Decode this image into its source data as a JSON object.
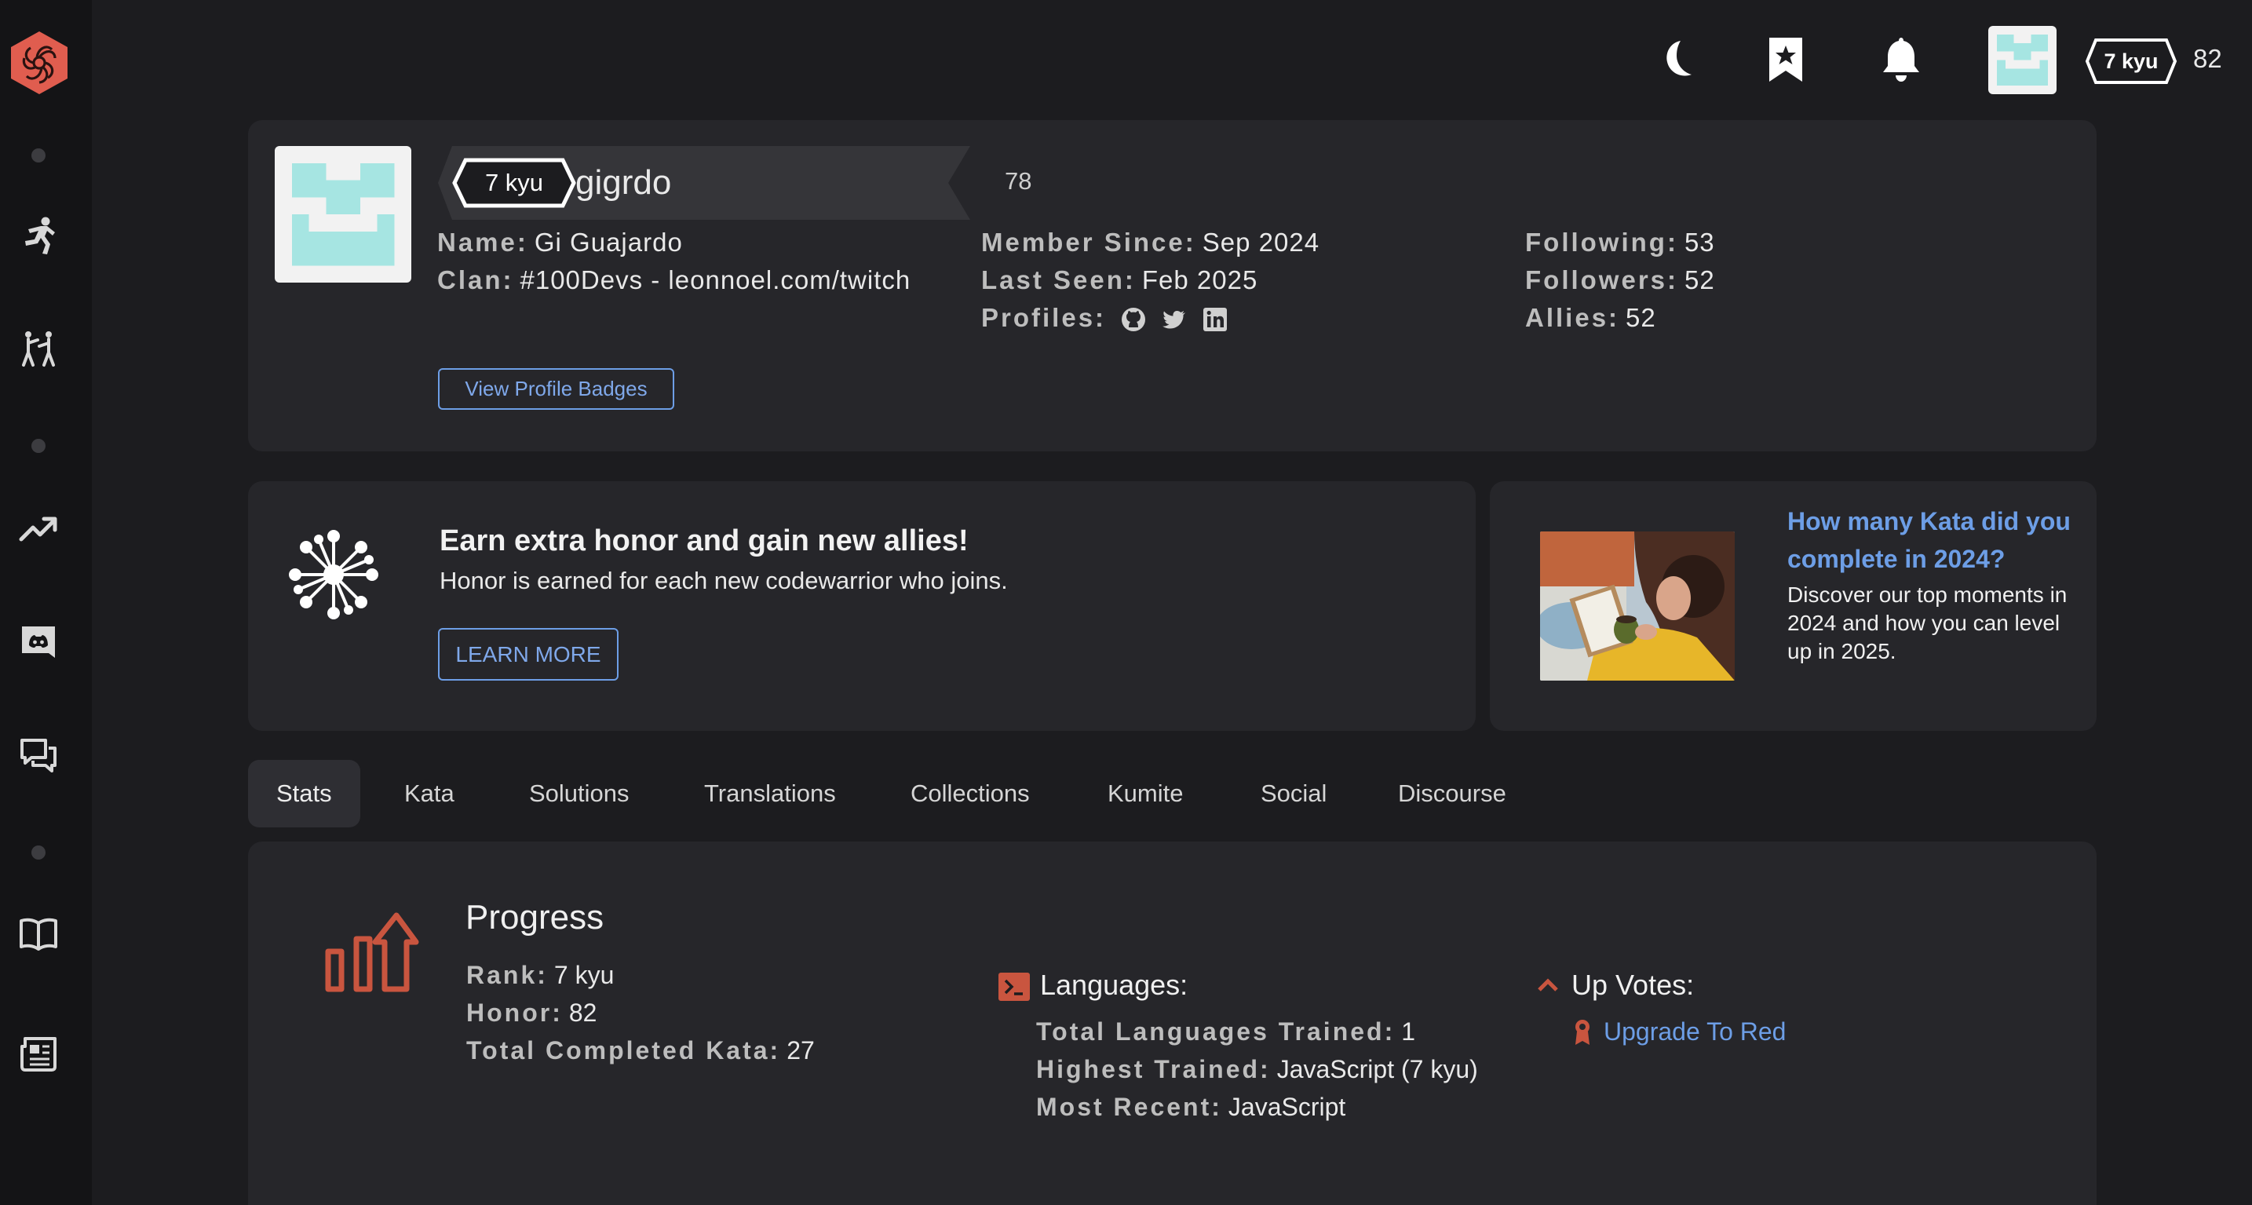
{
  "colors": {
    "background": "#1c1c1f",
    "sidebar": "#141416",
    "panel": "#26262a",
    "accent_red": "#e05d4f",
    "link_blue": "#6d9ee6",
    "avatar_teal": "#a6e5e2"
  },
  "sidebar": {
    "logo_icon": "codewars-logo-icon",
    "items": [
      {
        "icon": "practice-running-icon"
      },
      {
        "icon": "sparring-fight-icon"
      },
      {
        "icon": "leaderboard-trend-icon"
      },
      {
        "icon": "discord-icon"
      },
      {
        "icon": "discussion-chat-icon"
      },
      {
        "icon": "docs-book-icon"
      },
      {
        "icon": "news-icon"
      }
    ]
  },
  "topbar": {
    "icons": [
      "moon-icon",
      "bookmark-star-icon",
      "bell-icon"
    ],
    "rank": "7 kyu",
    "honor": "82"
  },
  "profile": {
    "rank": "7 kyu",
    "username": "gigrdo",
    "honor": "78",
    "name_label": "Name:",
    "name_value": "Gi Guajardo",
    "clan_label": "Clan:",
    "clan_value": "#100Devs - leonnoel.com/twitch",
    "member_since_label": "Member Since:",
    "member_since_value": "Sep 2024",
    "last_seen_label": "Last Seen:",
    "last_seen_value": "Feb 2025",
    "profiles_label": "Profiles:",
    "profile_icons": [
      "github-icon",
      "twitter-icon",
      "linkedin-icon"
    ],
    "following_label": "Following:",
    "following_value": "53",
    "followers_label": "Followers:",
    "followers_value": "52",
    "allies_label": "Allies:",
    "allies_value": "52",
    "badges_button": "View Profile Badges"
  },
  "promo": {
    "icon": "network-burst-icon",
    "title": "Earn extra honor and gain new allies!",
    "subtitle": "Honor is earned for each new codewarrior who joins.",
    "button": "LEARN MORE"
  },
  "kata_card": {
    "title": "How many Kata did you complete in 2024?",
    "text": "Discover our top moments in 2024 and how you can level up in 2025."
  },
  "tabs": [
    "Stats",
    "Kata",
    "Solutions",
    "Translations",
    "Collections",
    "Kumite",
    "Social",
    "Discourse"
  ],
  "active_tab": "Stats",
  "stats": {
    "progress_icon": "progress-chart-icon",
    "progress_title": "Progress",
    "rank_label": "Rank:",
    "rank_value": "7 kyu",
    "honor_label": "Honor:",
    "honor_value": "82",
    "completed_label": "Total Completed Kata:",
    "completed_value": "27",
    "languages_icon": "terminal-icon",
    "languages_title": "Languages:",
    "languages_trained_label": "Total Languages Trained:",
    "languages_trained_value": "1",
    "highest_label": "Highest Trained:",
    "highest_value": "JavaScript (7 kyu)",
    "recent_label": "Most Recent:",
    "recent_value": "JavaScript",
    "upvotes_icon": "chevron-up-icon",
    "upvotes_title": "Up Votes:",
    "upgrade_icon": "ribbon-icon",
    "upgrade_link": "Upgrade To Red"
  }
}
